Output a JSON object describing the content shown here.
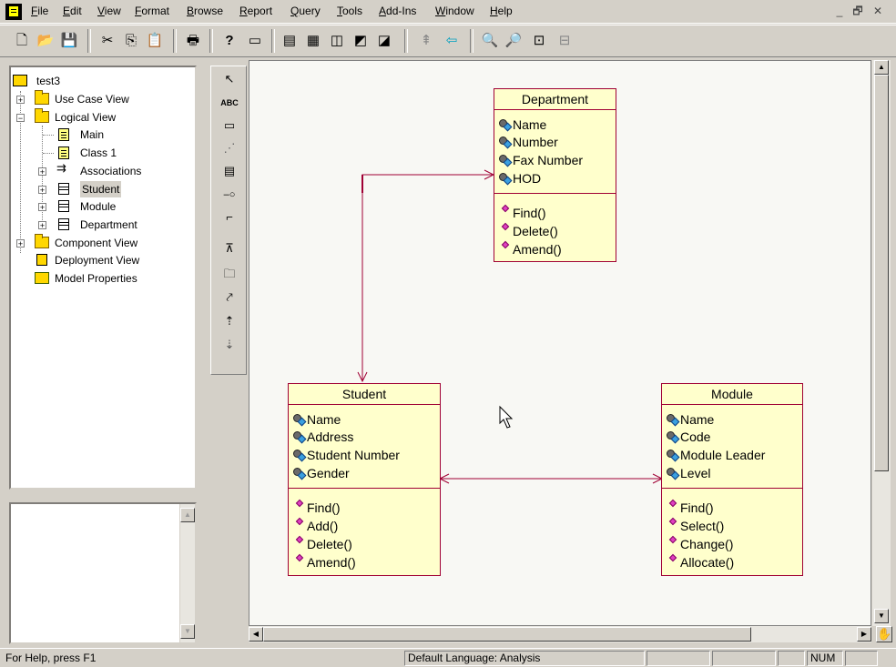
{
  "menu": {
    "items": [
      "File",
      "Edit",
      "View",
      "Format",
      "Browse",
      "Report",
      "Query",
      "Tools",
      "Add-Ins",
      "Window",
      "Help"
    ],
    "window_controls": [
      "_",
      "🗗",
      "✕"
    ]
  },
  "toolbar": {
    "buttons": [
      {
        "name": "new-icon",
        "glyph": "🗋"
      },
      {
        "name": "open-icon",
        "glyph": "📂"
      },
      {
        "name": "save-icon",
        "glyph": "💾"
      },
      {
        "name": "cut-icon",
        "glyph": "✂"
      },
      {
        "name": "copy-icon",
        "glyph": "⎘"
      },
      {
        "name": "paste-icon",
        "glyph": "📋"
      },
      {
        "name": "print-icon",
        "glyph": "🖶"
      },
      {
        "name": "context-help-icon",
        "glyph": "?"
      },
      {
        "name": "view-documentation-icon",
        "glyph": "▭"
      },
      {
        "name": "browse-class-diagram-icon",
        "glyph": "▤"
      },
      {
        "name": "browse-interaction-diagram-icon",
        "glyph": "▦"
      },
      {
        "name": "browse-component-diagram-icon",
        "glyph": "◫"
      },
      {
        "name": "browse-state-diagram-icon",
        "glyph": "◩"
      },
      {
        "name": "browse-deployment-diagram-icon",
        "glyph": "◪"
      },
      {
        "name": "browse-parent-icon",
        "glyph": "⇞"
      },
      {
        "name": "browse-previous-icon",
        "glyph": "⇦"
      },
      {
        "name": "zoom-in-icon",
        "glyph": "🔍"
      },
      {
        "name": "zoom-out-icon",
        "glyph": "🔎"
      },
      {
        "name": "fit-in-window-icon",
        "glyph": "⊡"
      },
      {
        "name": "undo-fit-icon",
        "glyph": "⊟"
      }
    ]
  },
  "tree": {
    "root": "test3",
    "items": [
      {
        "label": "Use Case View",
        "icon": "folder-icon"
      },
      {
        "label": "Logical View",
        "icon": "folder-icon"
      },
      {
        "label": "Main",
        "icon": "class-diagram-icon"
      },
      {
        "label": "Class 1",
        "icon": "class-diagram-icon"
      },
      {
        "label": "Associations",
        "icon": "associations-icon"
      },
      {
        "label": "Student",
        "icon": "class-icon"
      },
      {
        "label": "Module",
        "icon": "class-icon"
      },
      {
        "label": "Department",
        "icon": "class-icon"
      },
      {
        "label": "Component View",
        "icon": "folder-icon"
      },
      {
        "label": "Deployment View",
        "icon": "deployment-icon"
      },
      {
        "label": "Model Properties",
        "icon": "model-properties-icon"
      }
    ]
  },
  "toolbox": {
    "tools": [
      {
        "name": "selection-tool-icon",
        "glyph": "↖"
      },
      {
        "name": "text-tool-icon",
        "glyph": "ABC"
      },
      {
        "name": "note-tool-icon",
        "glyph": "▭"
      },
      {
        "name": "anchor-note-tool-icon",
        "glyph": "⋰"
      },
      {
        "name": "class-tool-icon",
        "glyph": "▤"
      },
      {
        "name": "interface-tool-icon",
        "glyph": "–○"
      },
      {
        "name": "association-tool-icon",
        "glyph": "⌐"
      },
      {
        "name": "unidirectional-association-tool-icon",
        "glyph": "⊼"
      },
      {
        "name": "package-tool-icon",
        "glyph": "🗀"
      },
      {
        "name": "dependency-tool-icon",
        "glyph": "⤤"
      },
      {
        "name": "generalization-tool-icon",
        "glyph": "⇡"
      },
      {
        "name": "realize-tool-icon",
        "glyph": "⇣"
      }
    ]
  },
  "diagram": {
    "classes": [
      {
        "name": "Department",
        "attributes": [
          "Name",
          "Number",
          "Fax Number",
          "HOD"
        ],
        "operations": [
          "Find()",
          "Delete()",
          "Amend()"
        ]
      },
      {
        "name": "Student",
        "attributes": [
          "Name",
          "Address",
          "Student Number",
          "Gender"
        ],
        "operations": [
          "Find()",
          "Add()",
          "Delete()",
          "Amend()"
        ]
      },
      {
        "name": "Module",
        "attributes": [
          "Name",
          "Code",
          "Module Leader",
          "Level"
        ],
        "operations": [
          "Find()",
          "Select()",
          "Change()",
          "Allocate()"
        ]
      }
    ],
    "line_color": "#a00034",
    "class_fill": "#ffffcc"
  },
  "status": {
    "help": "For Help, press F1",
    "language": "Default Language: Analysis",
    "num": "NUM"
  }
}
